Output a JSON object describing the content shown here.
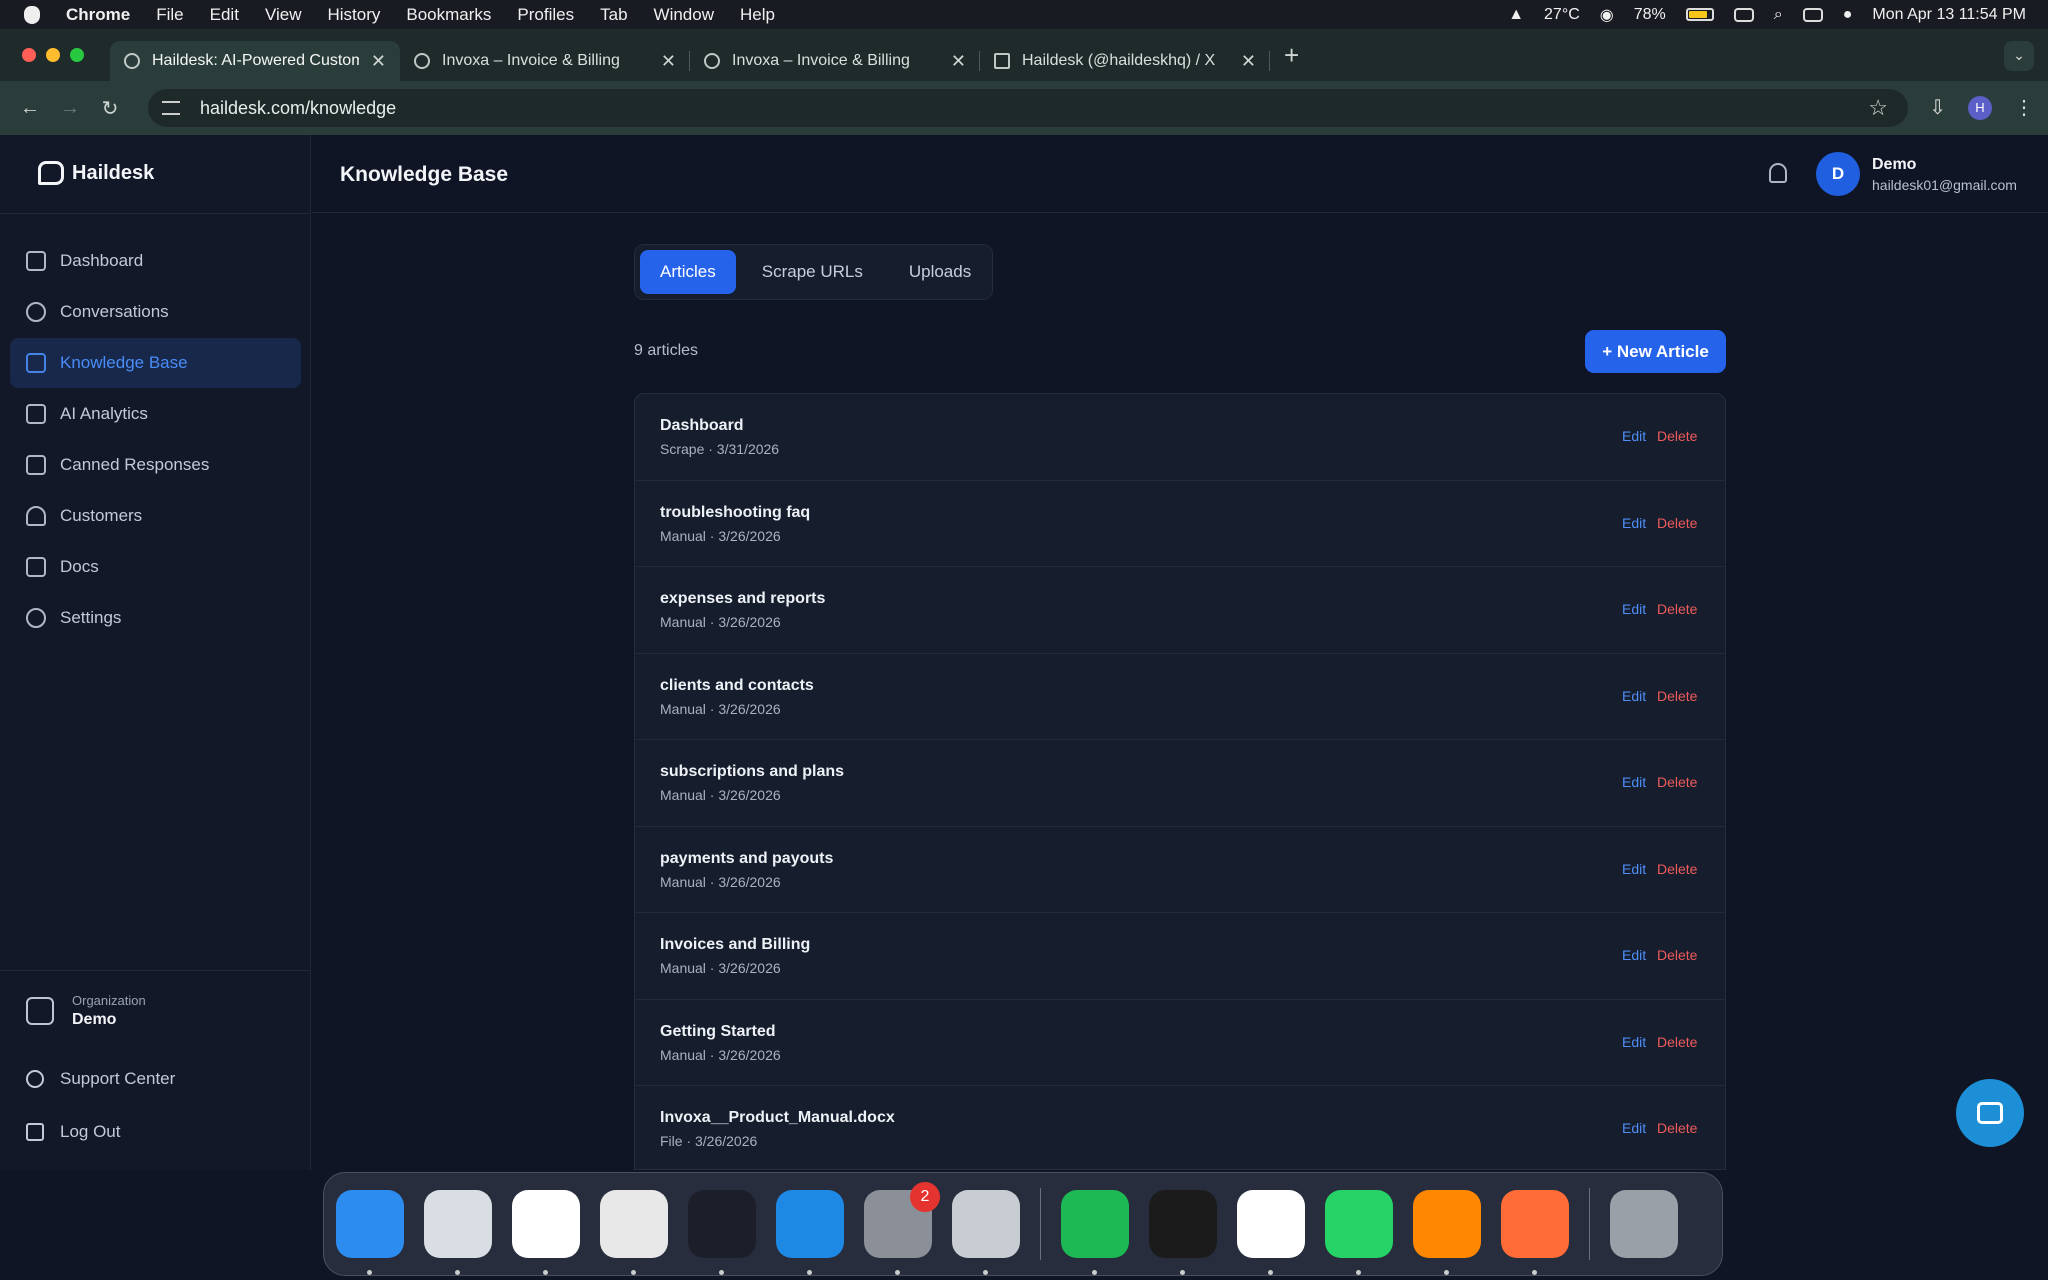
{
  "menubar": {
    "app": "Chrome",
    "items": [
      "File",
      "Edit",
      "View",
      "History",
      "Bookmarks",
      "Profiles",
      "Tab",
      "Window",
      "Help"
    ],
    "temp": "27°C",
    "battery": "78%",
    "datetime": "Mon Apr 13  11:54 PM"
  },
  "tabs": [
    {
      "title": "Haildesk: AI-Powered Custom",
      "active": true
    },
    {
      "title": "Invoxa – Invoice & Billing"
    },
    {
      "title": "Invoxa – Invoice & Billing"
    },
    {
      "title": "Haildesk (@haildeskhq) / X"
    }
  ],
  "address": {
    "url": "haildesk.com/knowledge",
    "profile_initial": "H"
  },
  "sidebar": {
    "brand": "Haildesk",
    "items": [
      {
        "label": "Dashboard"
      },
      {
        "label": "Conversations"
      },
      {
        "label": "Knowledge Base",
        "selected": true
      },
      {
        "label": "AI Analytics"
      },
      {
        "label": "Canned Responses"
      },
      {
        "label": "Customers"
      },
      {
        "label": "Docs"
      },
      {
        "label": "Settings"
      }
    ],
    "org_label": "Organization",
    "org_name": "Demo",
    "support": "Support Center",
    "logout": "Log Out"
  },
  "header": {
    "title": "Knowledge Base",
    "user_initial": "D",
    "user_name": "Demo",
    "user_email": "haildesk01@gmail.com"
  },
  "segments": [
    {
      "label": "Articles",
      "active": true
    },
    {
      "label": "Scrape URLs"
    },
    {
      "label": "Uploads"
    }
  ],
  "count": "9 articles",
  "new_button": "+ New Article",
  "row_actions": {
    "edit": "Edit",
    "delete": "Delete"
  },
  "articles": [
    {
      "title": "Dashboard",
      "meta": "Scrape · 3/31/2026"
    },
    {
      "title": "troubleshooting faq",
      "meta": "Manual · 3/26/2026"
    },
    {
      "title": "expenses and reports",
      "meta": "Manual · 3/26/2026"
    },
    {
      "title": "clients and contacts",
      "meta": "Manual · 3/26/2026"
    },
    {
      "title": "subscriptions and plans",
      "meta": "Manual · 3/26/2026"
    },
    {
      "title": "payments and payouts",
      "meta": "Manual · 3/26/2026"
    },
    {
      "title": "Invoices and Billing",
      "meta": "Manual · 3/26/2026"
    },
    {
      "title": "Getting Started",
      "meta": "Manual · 3/26/2026"
    },
    {
      "title": "Invoxa__Product_Manual.docx",
      "meta": "File · 3/26/2026"
    }
  ],
  "dock": {
    "apps": [
      {
        "name": "finder-icon",
        "color": "#2d8cf0"
      },
      {
        "name": "launchpad-icon",
        "color": "#d9dde4"
      },
      {
        "name": "vscode-icon",
        "color": "#ffffff"
      },
      {
        "name": "chrome-icon",
        "color": "#e8e8e8"
      },
      {
        "name": "arc-icon",
        "color": "#1c1f2a"
      },
      {
        "name": "safari-icon",
        "color": "#1e88e5"
      },
      {
        "name": "system-settings-icon",
        "color": "#8a8f98",
        "badge": "2"
      },
      {
        "name": "iphone-mirroring-icon",
        "color": "#c8ccd3"
      },
      {
        "name": "spotify-icon",
        "color": "#1db954"
      },
      {
        "name": "terminal-icon",
        "color": "#1b1b1b"
      },
      {
        "name": "mongodb-icon",
        "color": "#ffffff"
      },
      {
        "name": "whatsapp-icon",
        "color": "#25d366"
      },
      {
        "name": "vlc-icon",
        "color": "#ff8800"
      },
      {
        "name": "postman-icon",
        "color": "#ff6c37"
      },
      {
        "name": "trash-icon",
        "color": "#9aa0a8"
      }
    ]
  }
}
